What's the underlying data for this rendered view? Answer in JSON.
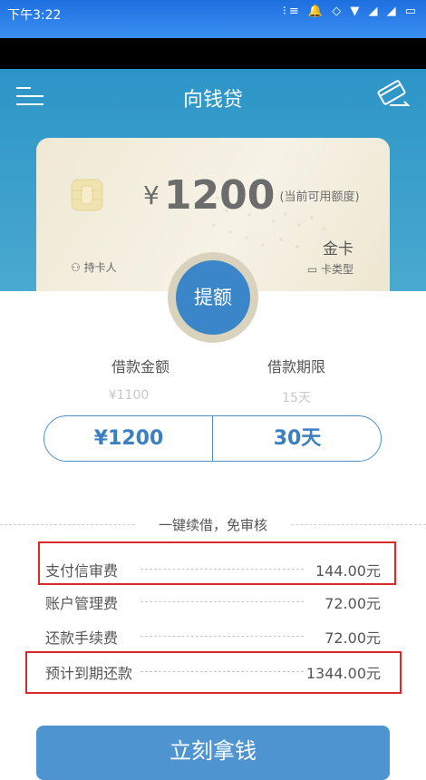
{
  "status_bar": {
    "time": "下午3:22",
    "icons": "⁝≡ 🔔 ◇ ▼ ◢ ◢ ▭"
  },
  "header": {
    "title": "向钱贷"
  },
  "card": {
    "currency": "¥",
    "amount": "1200",
    "amount_note": "(当前可用额度)",
    "level": "金卡",
    "holder_label": "持卡人",
    "type_label": "卡类型"
  },
  "raise_button": "提额",
  "loan": {
    "amount_label": "借款金额",
    "term_label": "借款期限",
    "amount_hint": "¥1100",
    "term_hint": "15天",
    "amount_value": "¥1200",
    "term_value": "30天"
  },
  "renew_text": "一键续借，免审核",
  "fees": [
    {
      "label": "支付信审费",
      "value": "144.00元"
    },
    {
      "label": "账户管理费",
      "value": "72.00元"
    },
    {
      "label": "还款手续费",
      "value": "72.00元"
    },
    {
      "label": "预计到期还款",
      "value": "1344.00元"
    }
  ],
  "submit_button": "立刻拿钱",
  "colors": {
    "header": "#2c95c7",
    "accent": "#3b86c8",
    "highlight_box": "#d92b2b"
  }
}
